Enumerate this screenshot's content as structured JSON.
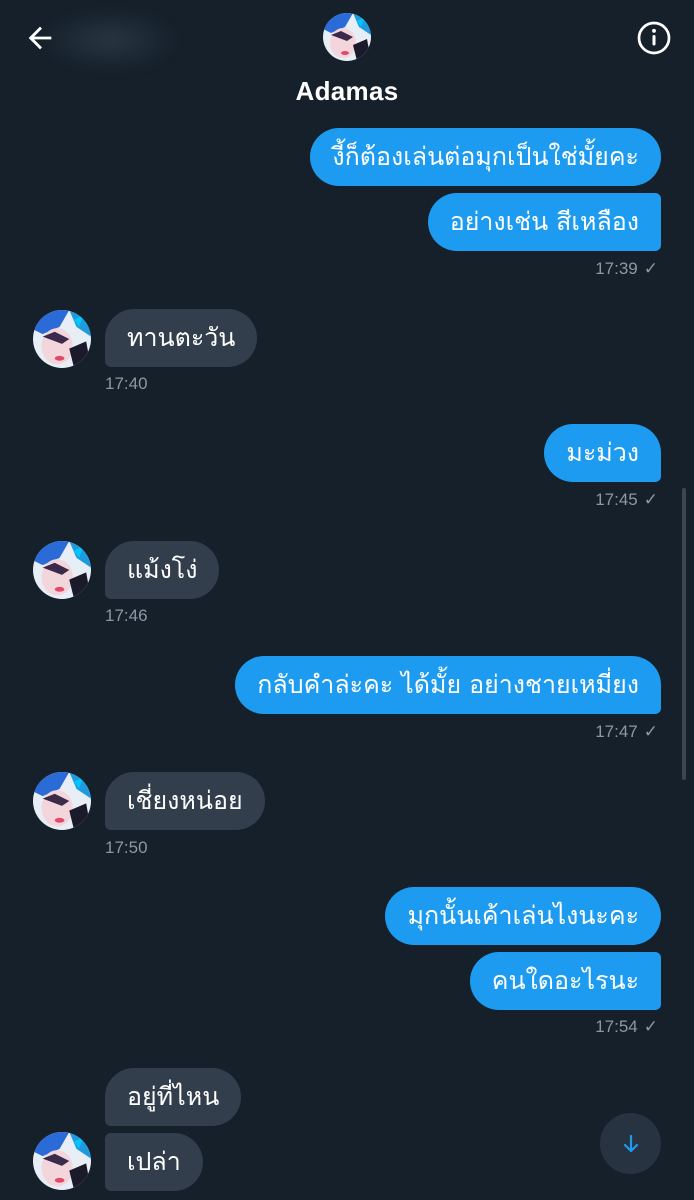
{
  "header": {
    "name": "Adamas",
    "back_icon": "arrow-left-icon",
    "info_icon": "info-icon"
  },
  "colors": {
    "background": "#15202b",
    "sent_bubble": "#1d9bf0",
    "received_bubble": "#323e4b",
    "timestamp": "#8b98a5"
  },
  "messages": [
    {
      "dir": "sent",
      "text": "งี้ก็ต้องเล่นต่อมุกเป็นใช่มั้ยคะ"
    },
    {
      "dir": "sent",
      "text": "อย่างเช่น สีเหลือง"
    },
    {
      "dir": "sent-time",
      "time": "17:39",
      "status": "✓"
    },
    {
      "dir": "recv",
      "text": "ทานตะวัน"
    },
    {
      "dir": "recv-time",
      "time": "17:40"
    },
    {
      "dir": "sent",
      "text": "มะม่วง"
    },
    {
      "dir": "sent-time",
      "time": "17:45",
      "status": "✓"
    },
    {
      "dir": "recv",
      "text": "แม้งโง่"
    },
    {
      "dir": "recv-time",
      "time": "17:46"
    },
    {
      "dir": "sent",
      "text": "กลับคำล่ะคะ ได้มั้ย อย่างชายเหมี่ยง"
    },
    {
      "dir": "sent-time",
      "time": "17:47",
      "status": "✓"
    },
    {
      "dir": "recv",
      "text": "เชี่ยงหน่อย"
    },
    {
      "dir": "recv-time",
      "time": "17:50"
    },
    {
      "dir": "sent",
      "text": "มุกนั้นเค้าเล่นไงนะคะ"
    },
    {
      "dir": "sent",
      "text": "คนใดอะไรนะ"
    },
    {
      "dir": "sent-time",
      "time": "17:54",
      "status": "✓"
    },
    {
      "dir": "recv",
      "text": "อยู่ที่ไหน"
    },
    {
      "dir": "recv",
      "text": "เปล่า"
    }
  ],
  "scroll_button": {
    "icon": "arrow-down-icon"
  }
}
